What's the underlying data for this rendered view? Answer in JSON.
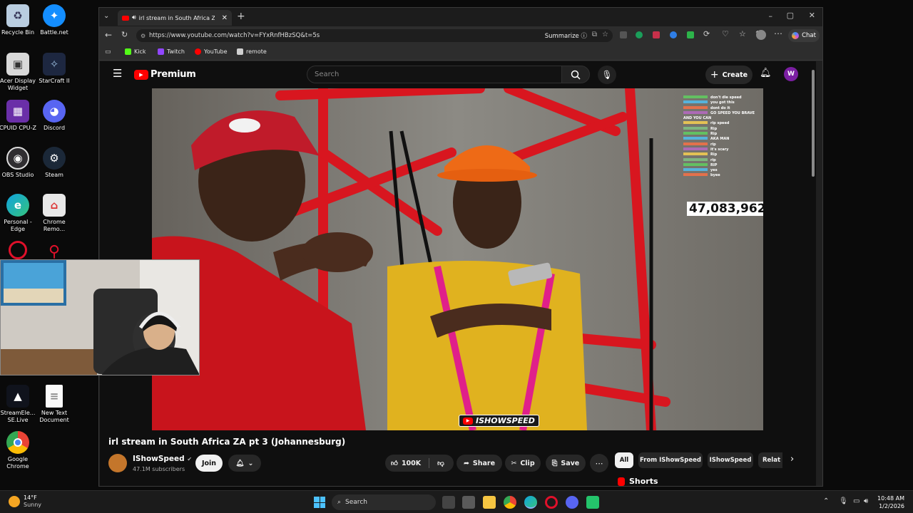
{
  "desktop": {
    "icons": [
      {
        "label": "Recycle Bin"
      },
      {
        "label": "Battle.net"
      },
      {
        "label": "Acer Display Widget"
      },
      {
        "label": "StarCraft II"
      },
      {
        "label": "CPUID CPU-Z"
      },
      {
        "label": "Discord"
      },
      {
        "label": "OBS Studio"
      },
      {
        "label": "Steam"
      },
      {
        "label": "Personal - Edge"
      },
      {
        "label": "Chrome Remo..."
      },
      {
        "label": "StreamEle... SE.Live"
      },
      {
        "label": "New Text Document"
      },
      {
        "label": "Google Chrome"
      }
    ]
  },
  "browser": {
    "tab_title": "irl stream in South Africa ZA pt",
    "url": "https://www.youtube.com/watch?v=FYxRnfHBzSQ&t=5s",
    "summarize_label": "Summarize",
    "chat_label": "Chat",
    "bookmarks": [
      {
        "label": "Kick",
        "color": "#53fc18"
      },
      {
        "label": "Twitch",
        "color": "#9146ff"
      },
      {
        "label": "YouTube",
        "color": "#ff0000"
      },
      {
        "label": "remote",
        "color": "#cfcfcf"
      }
    ]
  },
  "youtube": {
    "logo_text": "Premium",
    "search_placeholder": "Search",
    "create_label": "Create",
    "avatar_letter": "W",
    "video": {
      "counter": "47,083,962",
      "watermark": "ISHOWSPEED",
      "chat_messages": [
        {
          "user": "",
          "text": "don't die speed"
        },
        {
          "user": "",
          "text": "you got this"
        },
        {
          "user": "",
          "text": "dont do it"
        },
        {
          "user": "",
          "text": "GO SPEED YOU BRAVE AND YOU CAN"
        },
        {
          "user": "",
          "text": "rip speed"
        },
        {
          "user": "",
          "text": "Rip"
        },
        {
          "user": "",
          "text": "Rip"
        },
        {
          "user": "",
          "text": "AKA MAN"
        },
        {
          "user": "",
          "text": "rip"
        },
        {
          "user": "",
          "text": "it's scary"
        },
        {
          "user": "",
          "text": "Rip"
        },
        {
          "user": "",
          "text": "rip"
        },
        {
          "user": "",
          "text": "RIP"
        },
        {
          "user": "",
          "text": "yes"
        },
        {
          "user": "",
          "text": "byee"
        }
      ]
    },
    "title": "irl stream in South Africa ZA pt 3 (Johannesburg)",
    "channel": "IShowSpeed",
    "subscribers": "47.1M subscribers",
    "join_label": "Join",
    "likes": "100K",
    "share_label": "Share",
    "clip_label": "Clip",
    "save_label": "Save",
    "chips": [
      "All",
      "From IShowSpeed",
      "IShowSpeed",
      "Relat"
    ],
    "shorts_label": "Shorts"
  },
  "taskbar": {
    "weather_temp": "14°F",
    "weather_desc": "Sunny",
    "search_label": "Search",
    "time": "10:48 AM",
    "date": "1/2/2026"
  },
  "colors": {
    "yt_red": "#ff0000",
    "page_bg": "#0f0f0f",
    "avatar_purple": "#7b1fa2"
  }
}
